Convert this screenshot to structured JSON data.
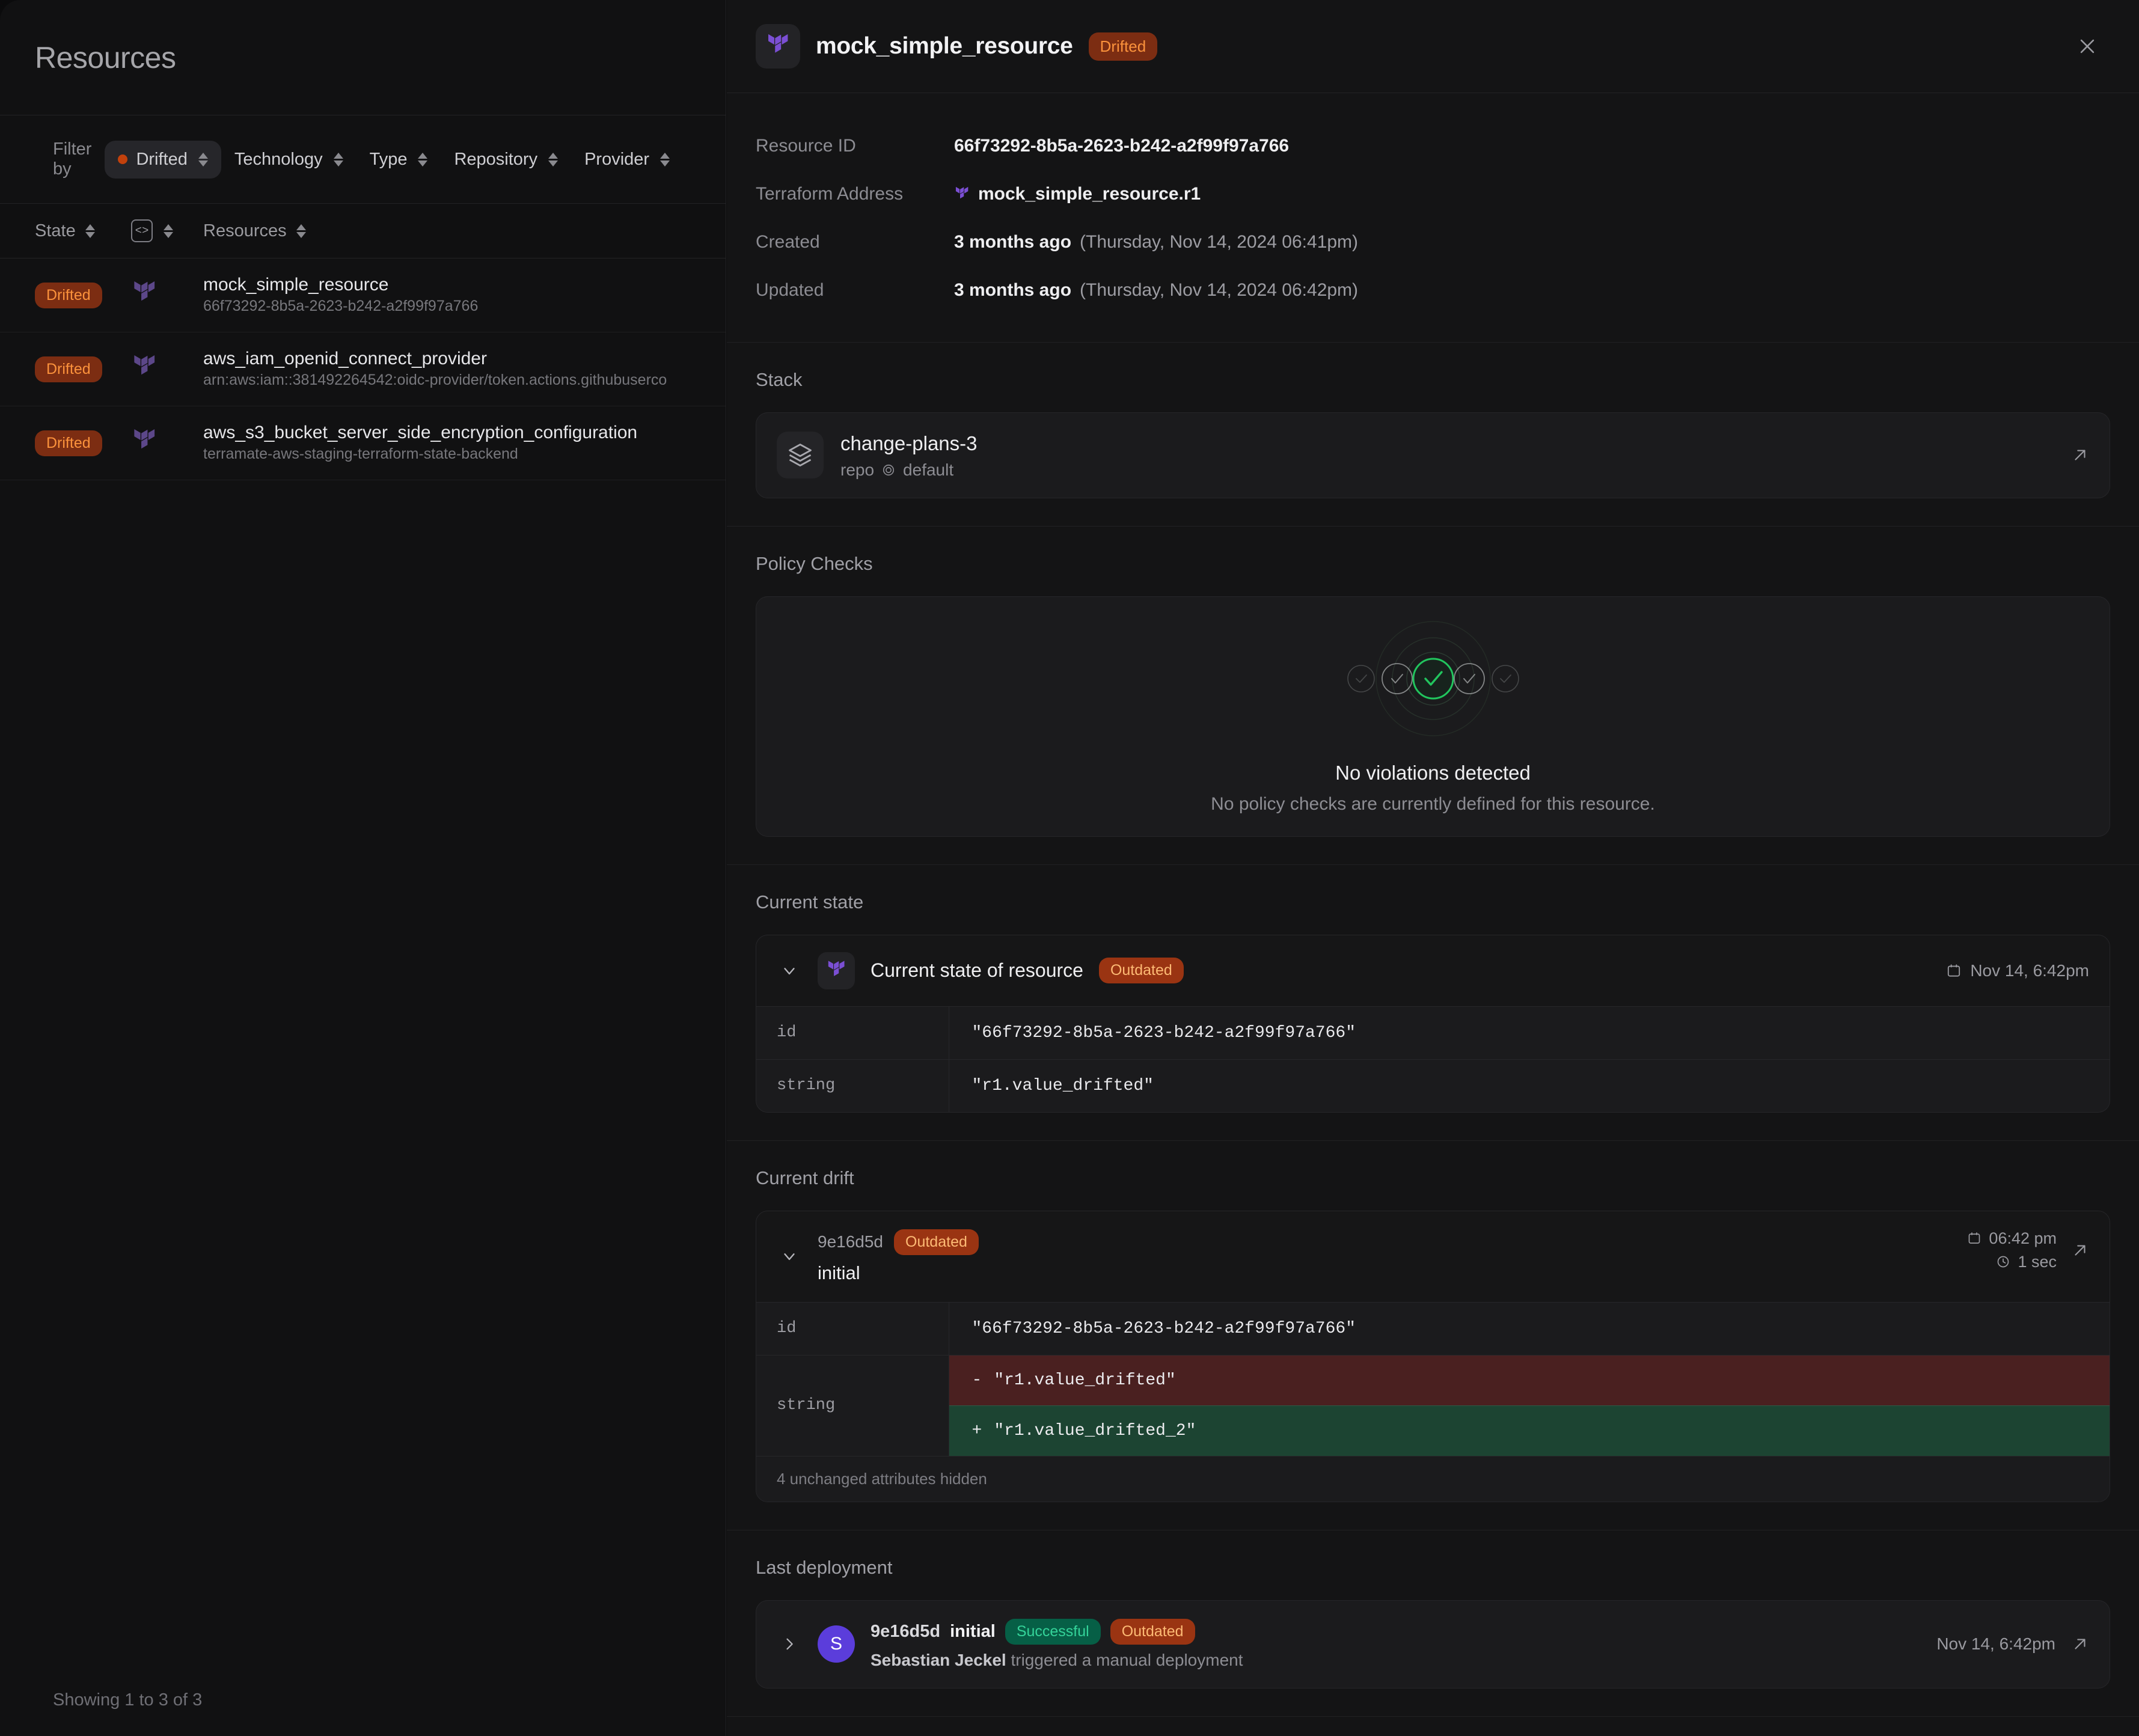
{
  "sidebar": {
    "title": "Resources",
    "filter": {
      "label": "Filter by",
      "chips": [
        {
          "label": "Drifted",
          "active": true
        },
        {
          "label": "Technology",
          "active": false
        },
        {
          "label": "Type",
          "active": false
        },
        {
          "label": "Repository",
          "active": false
        },
        {
          "label": "Provider",
          "active": false
        }
      ]
    },
    "columns": {
      "state": "State",
      "technology_icon": "code-icon",
      "resources": "Resources"
    },
    "rows": [
      {
        "state": "Drifted",
        "technology_icon": "terraform-icon",
        "name": "mock_simple_resource",
        "sub": "66f73292-8b5a-2623-b242-a2f99f97a766"
      },
      {
        "state": "Drifted",
        "technology_icon": "terraform-icon",
        "name": "aws_iam_openid_connect_provider",
        "sub": "arn:aws:iam::381492264542:oidc-provider/token.actions.githubuserco"
      },
      {
        "state": "Drifted",
        "technology_icon": "terraform-icon",
        "name": "aws_s3_bucket_server_side_encryption_configuration",
        "sub": "terramate-aws-staging-terraform-state-backend"
      }
    ],
    "footer": "Showing 1 to 3 of 3"
  },
  "detail": {
    "header": {
      "title": "mock_simple_resource",
      "badge": "Drifted",
      "close_icon": "close-icon"
    },
    "meta": [
      {
        "key": "Resource ID",
        "value": "66f73292-8b5a-2623-b242-a2f99f97a766",
        "icon": null,
        "soft": null
      },
      {
        "key": "Terraform Address",
        "value": "mock_simple_resource.r1",
        "icon": "terraform-icon",
        "soft": null
      },
      {
        "key": "Created",
        "value": "3 months ago",
        "icon": null,
        "soft": "(Thursday, Nov 14, 2024 06:41pm)"
      },
      {
        "key": "Updated",
        "value": "3 months ago",
        "icon": null,
        "soft": "(Thursday, Nov 14, 2024 06:42pm)"
      }
    ],
    "stack": {
      "section_title": "Stack",
      "icon": "layers-icon",
      "name": "change-plans-3",
      "repo_label": "repo",
      "target_icon": "target-icon",
      "target": "default",
      "open_icon": "external-link-icon"
    },
    "policy_checks": {
      "section_title": "Policy Checks",
      "illustration": "check-circles-icon",
      "heading": "No violations detected",
      "subtext": "No policy checks are currently defined for this resource.",
      "accent_color": "#22c55e"
    },
    "current_state": {
      "section_title": "Current state",
      "chevron_icon": "chevron-down-icon",
      "tech_icon": "terraform-icon",
      "title": "Current state of resource",
      "badge": "Outdated",
      "calendar_icon": "calendar-icon",
      "timestamp": "Nov 14, 6:42pm",
      "attributes": [
        {
          "key": "id",
          "value": "\"66f73292-8b5a-2623-b242-a2f99f97a766\""
        },
        {
          "key": "string",
          "value": "\"r1.value_drifted\""
        }
      ]
    },
    "current_drift": {
      "section_title": "Current drift",
      "chevron_icon": "chevron-down-icon",
      "sha": "9e16d5d",
      "badge": "Outdated",
      "title": "initial",
      "calendar_icon": "calendar-icon",
      "time": "06:42 pm",
      "clock_icon": "clock-icon",
      "duration": "1 sec",
      "open_icon": "external-link-icon",
      "attributes": [
        {
          "key": "id",
          "value": "\"66f73292-8b5a-2623-b242-a2f99f97a766\""
        }
      ],
      "diff": {
        "key": "string",
        "removed_marker": "-",
        "removed": "\"r1.value_drifted\"",
        "added_marker": "+",
        "added": "\"r1.value_drifted_2\""
      },
      "hidden_note": "4 unchanged attributes hidden"
    },
    "last_deployment": {
      "section_title": "Last deployment",
      "chevron_icon": "chevron-right-icon",
      "avatar_initial": "S",
      "sha": "9e16d5d",
      "title": "initial",
      "badges": [
        "Successful",
        "Outdated"
      ],
      "author": "Sebastian Jeckel",
      "action_text": "triggered a manual deployment",
      "timestamp": "Nov 14, 6:42pm",
      "open_icon": "external-link-icon"
    }
  }
}
